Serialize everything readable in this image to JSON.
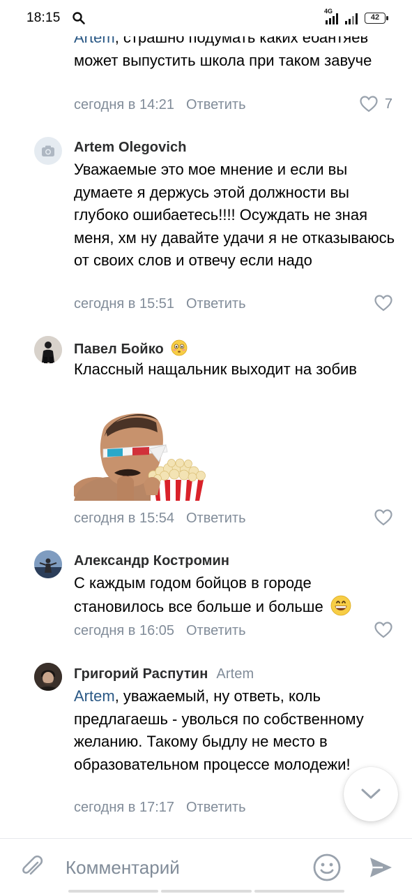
{
  "status_bar": {
    "time": "18:15",
    "network": "4G",
    "battery": "42"
  },
  "comments": [
    {
      "mention": "Artem",
      "text_rest": ", страшно подумать каких ебантяев может выпустить школа при таком завуче",
      "time": "сегодня в 14:21",
      "reply_label": "Ответить",
      "likes": "7"
    },
    {
      "author": "Artem Olegovich",
      "avatar_icon": "camera-icon",
      "text": "Уважаемые это мое мнение и если вы думаете я держусь этой должности вы глубоко ошибаетесь!!!! Осуждать не зная меня, хм ну давайте удачи  я не отказываюсь от своих слов и отвечу если надо",
      "time": "сегодня в 15:51",
      "reply_label": "Ответить"
    },
    {
      "author": "Павел Бойко",
      "author_emoji": "flushed-face-emoji",
      "text": "Классный нащальник выходит на зобив",
      "sticker": "popcorn-3d-glasses-sticker",
      "time": "сегодня в 15:54",
      "reply_label": "Ответить"
    },
    {
      "author": "Александр Костромин",
      "text": "С каждым годом бойцов в городе становилось все больше и больше",
      "text_emoji": "grinning-face-emoji",
      "time": "сегодня в 16:05",
      "reply_label": "Ответить"
    },
    {
      "author": "Григорий Распутин",
      "reply_to": "Artem",
      "mention": "Artem",
      "text_rest": ", уважаемый, ну ответь, коль предлагаешь - уволься по собственному желанию. Такому быдлу не место в образовательном процессе молодежи!",
      "time": "сегодня в 17:17",
      "reply_label": "Ответить"
    }
  ],
  "composer": {
    "placeholder": "Комментарий"
  },
  "colors": {
    "link": "#2a5885",
    "secondary": "#818c99",
    "accent": "#99a2ad"
  }
}
